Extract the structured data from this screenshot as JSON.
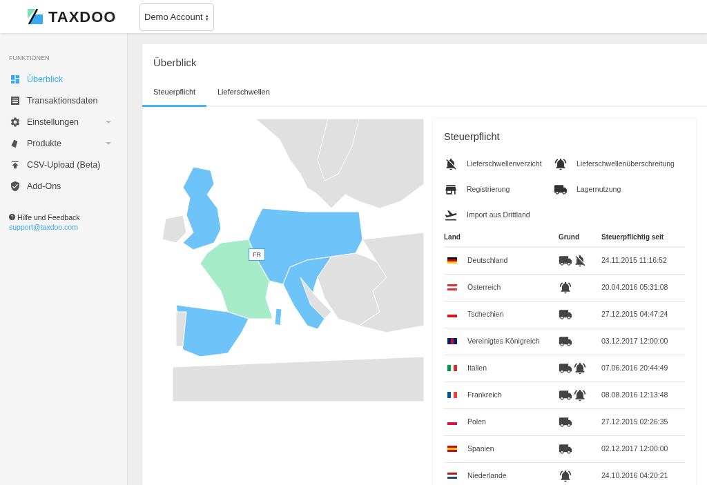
{
  "header": {
    "logo_text": "TAXDOO",
    "account_select": {
      "value": "Demo Account",
      "caret": "▴▾"
    }
  },
  "sidebar": {
    "section_title": "FUNKTIONEN",
    "items": [
      {
        "label": "Überblick",
        "kind": "dashboard",
        "selected": true,
        "expandable": false
      },
      {
        "label": "Transaktionsdaten",
        "kind": "list",
        "selected": false,
        "expandable": false
      },
      {
        "label": "Einstellungen",
        "kind": "gear",
        "selected": false,
        "expandable": true
      },
      {
        "label": "Produkte",
        "kind": "products",
        "selected": false,
        "expandable": true
      },
      {
        "label": "CSV-Upload (Beta)",
        "kind": "upload",
        "selected": false,
        "expandable": false
      },
      {
        "label": "Add-Ons",
        "kind": "shield",
        "selected": false,
        "expandable": false
      }
    ],
    "help": {
      "label": "Hilfe und Feedback",
      "email": "support@taxdoo.com"
    }
  },
  "page": {
    "title": "Überblick",
    "tabs": [
      {
        "label": "Steuerpflicht",
        "selected": true
      },
      {
        "label": "Lieferschwellen",
        "selected": false
      }
    ],
    "map": {
      "marker_label": "FR"
    },
    "panel": {
      "title": "Steuerpflicht",
      "legend": [
        {
          "label": "Lieferschwellenverzicht",
          "kind": "bell-off"
        },
        {
          "label": "Lieferschwellenüberschreitung",
          "kind": "bell-ring"
        },
        {
          "label": "Registrierung",
          "kind": "store"
        },
        {
          "label": "Lagernutzung",
          "kind": "truck"
        },
        {
          "label": "Import aus Drittland",
          "kind": "plane"
        }
      ],
      "table": {
        "columns": [
          "Land",
          "Grund",
          "Steuerpflichtig seit"
        ],
        "rows": [
          {
            "kind": "de",
            "country": "Deutschland",
            "reasons": [
              {
                "kind": "truck"
              },
              {
                "kind": "bell-off"
              }
            ],
            "since": "24.11.2015 11:16:52"
          },
          {
            "kind": "at",
            "country": "Österreich",
            "reasons": [
              {
                "kind": "bell-ring"
              }
            ],
            "since": "20.04.2016 05:31:08"
          },
          {
            "kind": "cz",
            "country": "Tschechien",
            "reasons": [
              {
                "kind": "truck"
              }
            ],
            "since": "27.12.2015 04:47:24"
          },
          {
            "kind": "gb",
            "country": "Vereinigtes Königreich",
            "reasons": [
              {
                "kind": "truck"
              }
            ],
            "since": "03.12.2017 12:00:00"
          },
          {
            "kind": "it",
            "country": "Italien",
            "reasons": [
              {
                "kind": "truck"
              },
              {
                "kind": "bell-ring"
              }
            ],
            "since": "07.06.2016 20:44:49"
          },
          {
            "kind": "fr",
            "country": "Frankreich",
            "reasons": [
              {
                "kind": "truck"
              },
              {
                "kind": "bell-ring"
              }
            ],
            "since": "08.08.2016 12:13:48"
          },
          {
            "kind": "pl",
            "country": "Polen",
            "reasons": [
              {
                "kind": "truck"
              }
            ],
            "since": "27.12.2015 02:26:35"
          },
          {
            "kind": "es",
            "country": "Spanien",
            "reasons": [
              {
                "kind": "truck"
              }
            ],
            "since": "02.12.2017 12:00:00"
          },
          {
            "kind": "nl",
            "country": "Niederlande",
            "reasons": [
              {
                "kind": "bell-ring"
              }
            ],
            "since": "24.10.2016 04:20:21"
          }
        ]
      }
    }
  }
}
